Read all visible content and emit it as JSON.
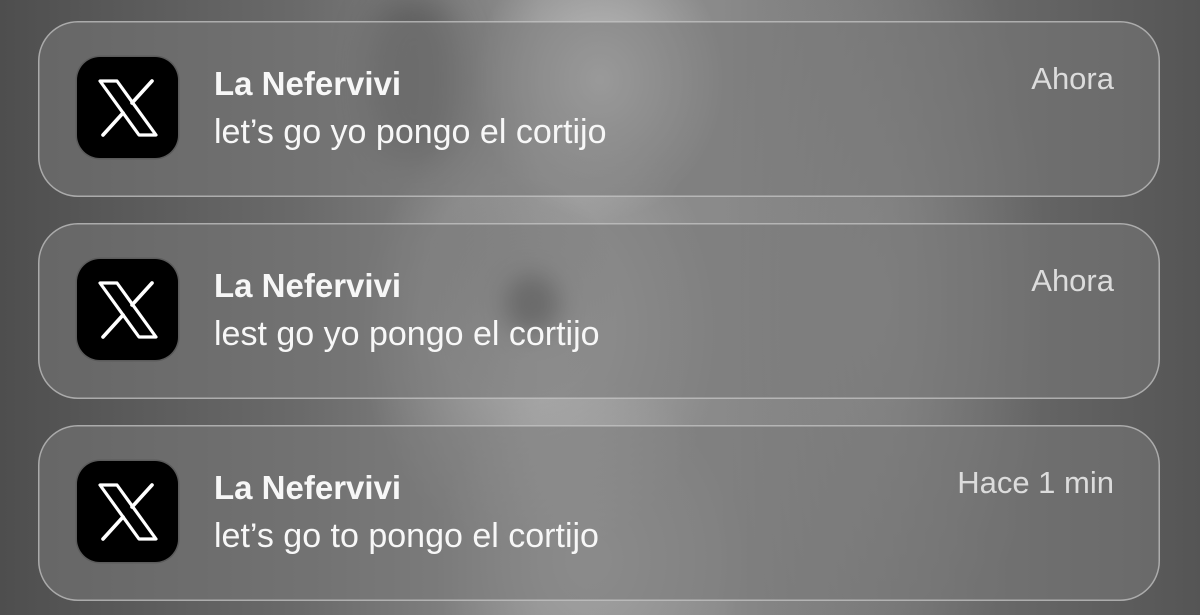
{
  "notifications": [
    {
      "app_icon": "x-logo-icon",
      "sender": "La Nefervivi",
      "message": "let’s go yo pongo el cortijo",
      "time": "Ahora"
    },
    {
      "app_icon": "x-logo-icon",
      "sender": "La Nefervivi",
      "message": "lest go yo pongo el cortijo",
      "time": "Ahora"
    },
    {
      "app_icon": "x-logo-icon",
      "sender": "La Nefervivi",
      "message": "let’s go to pongo el cortijo",
      "time": "Hace 1 min"
    }
  ],
  "colors": {
    "card_fill": "#787878",
    "card_border": "#e1e1e1",
    "text_primary": "#f7f7f7",
    "text_secondary": "#dcdcdc",
    "icon_background": "#000000"
  }
}
